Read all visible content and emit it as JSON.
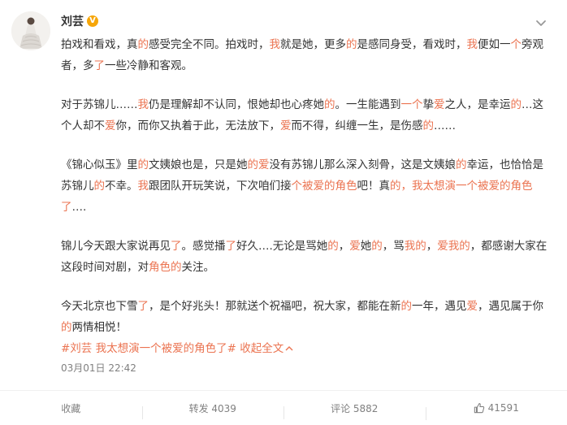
{
  "user": {
    "name": "刘芸",
    "verified_badge": "V"
  },
  "post": {
    "paragraphs": [
      [
        {
          "t": "拍戏和看戏，真"
        },
        {
          "t": "的",
          "h": 1
        },
        {
          "t": "感受完全不同。拍戏时，"
        },
        {
          "t": "我",
          "h": 1
        },
        {
          "t": "就是她，更多"
        },
        {
          "t": "的",
          "h": 1
        },
        {
          "t": "是感同身受，看戏时，"
        },
        {
          "t": "我",
          "h": 1
        },
        {
          "t": "便如一"
        },
        {
          "t": "个",
          "h": 1
        },
        {
          "t": "旁观者，多"
        },
        {
          "t": "了",
          "h": 1
        },
        {
          "t": "一些冷静和客观。"
        }
      ],
      [
        {
          "t": "对于苏锦儿……"
        },
        {
          "t": "我",
          "h": 1
        },
        {
          "t": "仍是理解却不认同，恨她却也心疼她"
        },
        {
          "t": "的",
          "h": 1
        },
        {
          "t": "。一生能遇到"
        },
        {
          "t": "一个",
          "h": 1
        },
        {
          "t": "挚"
        },
        {
          "t": "爱",
          "h": 1
        },
        {
          "t": "之人，是幸运"
        },
        {
          "t": "的",
          "h": 1
        },
        {
          "t": "…这个人却不"
        },
        {
          "t": "爱",
          "h": 1
        },
        {
          "t": "你，而你又执着于此，无法放下，"
        },
        {
          "t": "爱",
          "h": 1
        },
        {
          "t": "而不得，纠缠一生，是伤感"
        },
        {
          "t": "的",
          "h": 1
        },
        {
          "t": "……"
        }
      ],
      [
        {
          "t": "《锦心似玉》里"
        },
        {
          "t": "的",
          "h": 1
        },
        {
          "t": "文姨娘也是，只是她"
        },
        {
          "t": "的爱",
          "h": 1
        },
        {
          "t": "没有苏锦儿那么深入刻骨，这是文姨娘"
        },
        {
          "t": "的",
          "h": 1
        },
        {
          "t": "幸运，也恰"
        },
        {
          "t": "恰是苏锦儿"
        },
        {
          "t": "的",
          "h": 1
        },
        {
          "t": "不幸。"
        },
        {
          "t": "我",
          "h": 1
        },
        {
          "t": "跟团队开玩笑说，下次咱们接"
        },
        {
          "t": "个被爱的角色",
          "h": 1
        },
        {
          "t": "吧！真"
        },
        {
          "t": "的，我太想演一个被爱",
          "h": 1
        },
        {
          "t": "的角色了",
          "h": 1
        },
        {
          "t": "…."
        }
      ],
      [
        {
          "t": "锦儿今天跟大家说再见"
        },
        {
          "t": "了",
          "h": 1
        },
        {
          "t": "。感觉播"
        },
        {
          "t": "了",
          "h": 1
        },
        {
          "t": "好久….无论是骂她"
        },
        {
          "t": "的",
          "h": 1
        },
        {
          "t": "，"
        },
        {
          "t": "爱",
          "h": 1
        },
        {
          "t": "她"
        },
        {
          "t": "的",
          "h": 1
        },
        {
          "t": "，骂"
        },
        {
          "t": "我的",
          "h": 1
        },
        {
          "t": "，"
        },
        {
          "t": "爱我的",
          "h": 1
        },
        {
          "t": "，都感谢大"
        },
        {
          "t": "家在这段时间对剧，对"
        },
        {
          "t": "角色的",
          "h": 1
        },
        {
          "t": "关注。"
        }
      ],
      [
        {
          "t": "今天北京也下雪"
        },
        {
          "t": "了",
          "h": 1
        },
        {
          "t": "，是个好兆头！那就送个祝福吧，祝大家，都能在新"
        },
        {
          "t": "的",
          "h": 1
        },
        {
          "t": "一年，遇见"
        },
        {
          "t": "爱",
          "h": 1
        },
        {
          "t": "，遇见属"
        },
        {
          "t": "于你"
        },
        {
          "t": "的",
          "h": 1
        },
        {
          "t": "两情相悦！"
        }
      ]
    ],
    "hashtag": "#刘芸 我太想演一个被爱的角色了#",
    "collapse_label": "收起全文",
    "timestamp": "03月01日 22:42"
  },
  "actions": {
    "favorite": "收藏",
    "repost": "转发 4039",
    "comment": "评论 5882",
    "like_count": "41591"
  },
  "colors": {
    "highlight": "#eb7350",
    "text": "#333333",
    "meta": "#808080",
    "badge": "#f6a609"
  }
}
